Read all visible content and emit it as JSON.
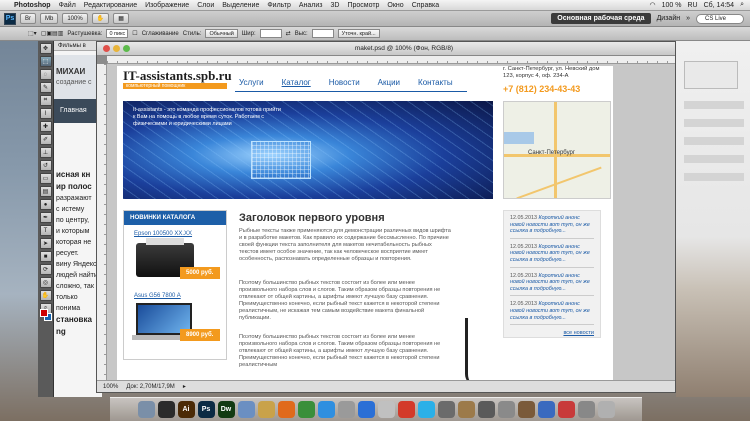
{
  "menubar": {
    "app": "Photoshop",
    "items": [
      "Файл",
      "Редактирование",
      "Изображение",
      "Слои",
      "Выделение",
      "Фильтр",
      "Анализ",
      "3D",
      "Просмотр",
      "Окно",
      "Справка"
    ],
    "status": {
      "battery": "100 %",
      "lang": "RU",
      "time": "Сб, 14:54"
    }
  },
  "appbar": {
    "logo": "Ps",
    "zoom": "100%",
    "workspace_active": "Основная рабочая среда",
    "workspace_design": "Дизайн",
    "search_placeholder": "CS Live"
  },
  "options": {
    "feather_label": "Растушевка:",
    "feather_value": "0 пикс",
    "antialias_label": "Сглаживание",
    "style_label": "Стиль:",
    "style_value": "Обычный",
    "width_label": "Шир:",
    "height_label": "Выс:",
    "refine_button": "Уточн. край..."
  },
  "background_page": {
    "tab": "Фильмы в",
    "title": "МИХАИ",
    "subtitle": "создание с",
    "nav": "Главная",
    "lines": [
      "исная кн",
      "",
      "ир полос",
      "разражают",
      "с истему",
      "по центру,",
      "и которым",
      "которая не",
      "ресует.",
      "",
      "вину Яндекс",
      "людей найти",
      "сложно, так",
      "только понима",
      "",
      "становка ng"
    ]
  },
  "document": {
    "title": "maket.psd @ 100% (Фон, RGB/8)",
    "status_zoom": "100%",
    "status_doc": "Док: 2,70М/17,9М"
  },
  "site": {
    "logo": "IT-assistants.spb.ru",
    "tagline": "компьютерный помощник",
    "nav": [
      "Услуги",
      "Каталог",
      "Новости",
      "Акции",
      "Контакты"
    ],
    "address": "г. Санкт-Петербург, ул. Невский дом 123, корпус 4, оф. 234-А",
    "phone": "+7 (812) 234-43-43",
    "hero_text": "It-assistants - это команда профессионалов готова прийти к Вам на помощь в любое время суток. Работаем с физическими и юридическими лицами",
    "map_city": "Санкт-Петербург",
    "catalog": {
      "header": "НОВИНКИ КАТАЛОГА",
      "products": [
        {
          "name": "Epson 100500 XX.XX",
          "price": "5000 руб."
        },
        {
          "name": "Asus G56 7800 A",
          "price": "8900 руб."
        }
      ]
    },
    "heading": "Заголовок первого уровня",
    "paragraphs": [
      "Рыбные тексты также применяются для демонстрации различных видов шрифта и в разработке макетов. Как правило их содержание бессмысленно. По причине своей функции текста заполнителя для макетов нечитабельность рыбных текстов имеет особое значение, так как человеческое восприятие имеет особенность, распознавать определенные образцы и повторения.",
      "Поэтому большинство рыбных текстов состоит из более или менее произвольного набора слов и слогов. Таким образом образцы повторения не отвлекают от общей картины, а шрифты имеют лучшую базу сравнения. Преимущественно конечно, если рыбный текст кажется в некоторой степени реалистичным, не искажая тем самым воздействие макета финальной публикации.",
      "Поэтому большинство рыбных текстов состоит из более или менее произвольного набора слов и слогов. Таким образом образцы повторения не отвлекают от общей картины, а шрифты имеют лучшую базу сравнения. Преимущественно конечно, если рыбный текст кажется в некоторой степени реалистичным"
    ],
    "news": [
      {
        "date": "12.05.2013",
        "text": "Короткий анонс новой новости вот тут, он же ссылка в подробную..."
      },
      {
        "date": "12.05.2013",
        "text": "Короткий анонс новой новости вот тут, он же ссылка в подробную..."
      },
      {
        "date": "12.05.2013",
        "text": "Короткий анонс новой новости вот тут, он же ссылка в подробную..."
      },
      {
        "date": "12.05.2013",
        "text": "Короткий анонс новой новости вот тут, он же ссылка в подробную..."
      }
    ],
    "news_all": "все новости"
  },
  "tools": [
    "move",
    "marquee",
    "lasso",
    "quick-select",
    "crop",
    "eyedropper",
    "heal",
    "brush",
    "stamp",
    "history-brush",
    "eraser",
    "gradient",
    "dodge",
    "pen",
    "type",
    "path-select",
    "shape",
    "3d-rotate",
    "3d-camera",
    "hand",
    "zoom"
  ],
  "dock": [
    {
      "label": "",
      "color": "#7a8fa8"
    },
    {
      "label": "",
      "color": "#2b2b2b"
    },
    {
      "label": "Ai",
      "color": "#4b2a06"
    },
    {
      "label": "Ps",
      "color": "#0b2a44"
    },
    {
      "label": "Dw",
      "color": "#123a12"
    },
    {
      "label": "",
      "color": "#6b8fc2"
    },
    {
      "label": "",
      "color": "#c9a24a"
    },
    {
      "label": "",
      "color": "#e06a1c"
    },
    {
      "label": "",
      "color": "#3a8f3a"
    },
    {
      "label": "",
      "color": "#2f8fe0"
    },
    {
      "label": "",
      "color": "#9a9a9a"
    },
    {
      "label": "",
      "color": "#2a6fd6"
    },
    {
      "label": "",
      "color": "#c0c0c0"
    },
    {
      "label": "",
      "color": "#d33a2a"
    },
    {
      "label": "",
      "color": "#2bb0e8"
    },
    {
      "label": "",
      "color": "#6b6b6b"
    },
    {
      "label": "",
      "color": "#9c7a4a"
    },
    {
      "label": "",
      "color": "#5a5a5a"
    },
    {
      "label": "",
      "color": "#8a8a8a"
    },
    {
      "label": "",
      "color": "#7a5a3a"
    },
    {
      "label": "",
      "color": "#3a6abf"
    },
    {
      "label": "",
      "color": "#c83a3a"
    },
    {
      "label": "",
      "color": "#888"
    },
    {
      "label": "",
      "color": "#b0b0b0"
    }
  ]
}
